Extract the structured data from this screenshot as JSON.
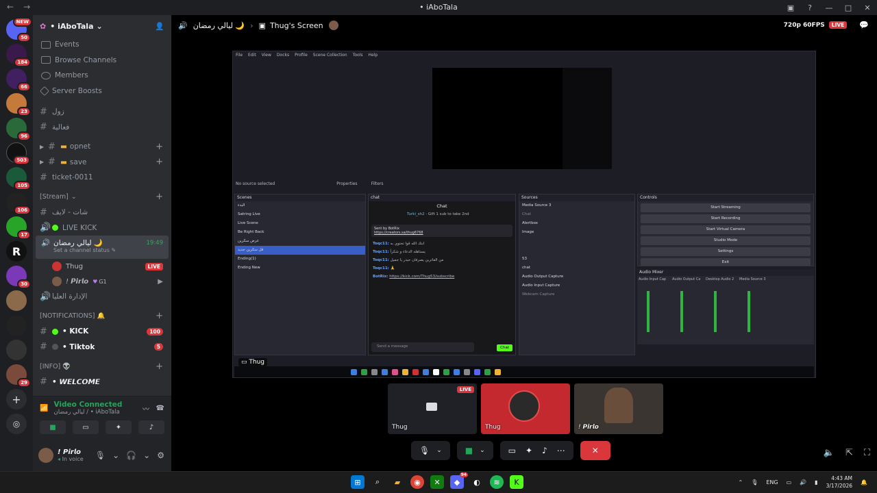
{
  "window": {
    "title": "• iAboTala"
  },
  "guild_badges": [
    "NEW",
    "50",
    "184",
    "66",
    "23",
    "96",
    "503",
    "105",
    "106",
    "17",
    "30",
    "29"
  ],
  "server": {
    "name": "• iAboTala"
  },
  "menu": [
    "Events",
    "Browse Channels",
    "Members",
    "Server Boosts"
  ],
  "channels": {
    "zool": "زول",
    "faaliya": "فعالية",
    "opnet": "opnet",
    "save": "save",
    "ticket": "ticket-0011",
    "stream_cat": "[Stream]",
    "shat": "شات - لايف",
    "live_kick": "LIVE KICK",
    "voice_name": "ليالي رمضان 🌙",
    "voice_time": "19:49",
    "voice_status": "Set a channel status",
    "user1": "Thug",
    "user1_badge": "LIVE",
    "user2": "! 𝙋𝙞𝙧𝙡𝙤",
    "user2_tag": "G1",
    "admin": "الإدارة العليا",
    "notif_cat": "[NOTIFICATIONS] 🔔",
    "kick": "• KICK",
    "kick_count": "100",
    "tiktok": "• Tiktok",
    "tiktok_count": "5",
    "info_cat": "[INFO] 👽",
    "welcome": "• 𝙒𝙀𝙇𝘾𝙊𝙈𝙀"
  },
  "voice_connected": {
    "title": "Video Connected",
    "subtitle": "ليالي رمضان / • iAboTala"
  },
  "user_panel": {
    "name": "! 𝙋𝙞𝙧𝙡𝙤",
    "status": "In voice"
  },
  "stage": {
    "channel": "ليالي رمضان 🌙",
    "screen": "Thug's Screen",
    "quality": "720p 60FPS",
    "live": "LIVE"
  },
  "obs": {
    "menu": [
      "File",
      "Edit",
      "View",
      "Docks",
      "Profile",
      "Scene Collection",
      "Tools",
      "Help"
    ],
    "no_source": "No source selected",
    "properties": "Properties",
    "filters": "Filters",
    "scenes_title": "Scenes",
    "scenes": [
      "البدء",
      "Satring Live",
      "Live Scene",
      "Be Right Back",
      "عرض سكرين",
      "قل سكرين جديد",
      "Ending(1)",
      "Ending New"
    ],
    "chat_title": "chat",
    "chat_header": "Chat",
    "chat_user": "Turki_sh2",
    "chat_gift": "Gift 1 sub to take 2nd",
    "pinned_by": "Sent by BotRix",
    "pinned_link": "https://creators.sa/thug6768",
    "msgs": [
      {
        "u": "Toqc11:",
        "t": "ابتك الله قوا تحتوي به"
      },
      {
        "u": "Toqc11:",
        "t": "يستاهله الدعاء و شكراً"
      },
      {
        "u": "Toqc11:",
        "t": "من الفاترين يصرفان حيدر يا جميل"
      },
      {
        "u": "Toqc11:",
        "t": "🙏"
      },
      {
        "u": "BotRix:",
        "t": "https://kick.com/Thug53/subscribe"
      }
    ],
    "send_placeholder": "Send a message",
    "chat_button": "Chat",
    "sources_title": "Sources",
    "sources": [
      "Media Source 3",
      "Chat",
      "Alertbox",
      "Image",
      "",
      "",
      "53",
      "chat",
      "Audio Output Capture",
      "Audio Input Capture",
      "Webcam Capture"
    ],
    "controls_title": "Controls",
    "controls": [
      "Start Streaming",
      "Start Recording",
      "Start Virtual Camera",
      "Studio Mode",
      "Settings",
      "Exit"
    ],
    "mixer_title": "Audio Mixer",
    "mixer": [
      "Audio Input Cap",
      "Audio Output Ca",
      "Desktop Audio 2",
      "Media Source 3"
    ],
    "cursor_label": "Thug"
  },
  "tiles": [
    {
      "name": "Thug",
      "live": "LIVE"
    },
    {
      "name": "Thug"
    },
    {
      "name": "! 𝙋𝙞𝙧𝙡𝙤"
    }
  ],
  "taskbar": {
    "lang": "ENG",
    "time": "4:43 AM",
    "date": "3/17/2026",
    "badge": "94"
  }
}
